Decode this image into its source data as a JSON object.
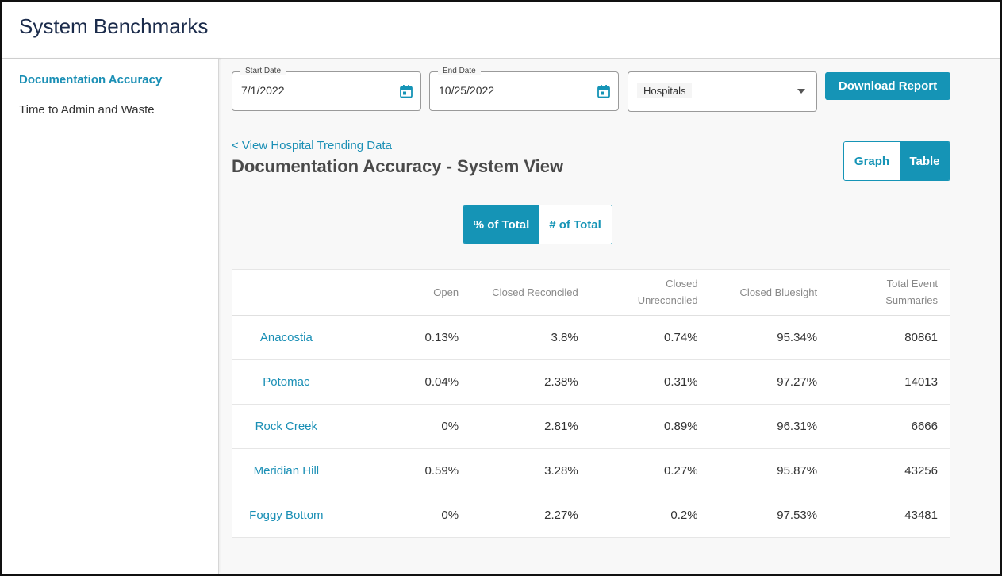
{
  "app": {
    "title": "System Benchmarks"
  },
  "sidebar": {
    "items": [
      {
        "label": "Documentation Accuracy",
        "active": true
      },
      {
        "label": "Time to Admin and Waste",
        "active": false
      }
    ]
  },
  "filters": {
    "start_date": {
      "label": "Start Date",
      "value": "7/1/2022"
    },
    "end_date": {
      "label": "End Date",
      "value": "10/25/2022"
    },
    "hospitals": {
      "value": "Hospitals"
    },
    "download_label": "Download Report"
  },
  "view": {
    "back_link": "< View Hospital Trending Data",
    "title": "Documentation Accuracy - System View",
    "graph_label": "Graph",
    "table_label": "Table",
    "pct_label": "% of Total",
    "num_label": "# of Total"
  },
  "table": {
    "headers": [
      "",
      "Open",
      "Closed Reconciled",
      "Closed Unreconciled",
      "Closed Bluesight",
      "Total Event Summaries"
    ],
    "rows": [
      [
        "Anacostia",
        "0.13%",
        "3.8%",
        "0.74%",
        "95.34%",
        "80861"
      ],
      [
        "Potomac",
        "0.04%",
        "2.38%",
        "0.31%",
        "97.27%",
        "14013"
      ],
      [
        "Rock Creek",
        "0%",
        "2.81%",
        "0.89%",
        "96.31%",
        "6666"
      ],
      [
        "Meridian Hill",
        "0.59%",
        "3.28%",
        "0.27%",
        "95.87%",
        "43256"
      ],
      [
        "Foggy Bottom",
        "0%",
        "2.27%",
        "0.2%",
        "97.53%",
        "43481"
      ]
    ]
  },
  "colors": {
    "accent": "#1594b6",
    "title": "#1b2b4b"
  }
}
